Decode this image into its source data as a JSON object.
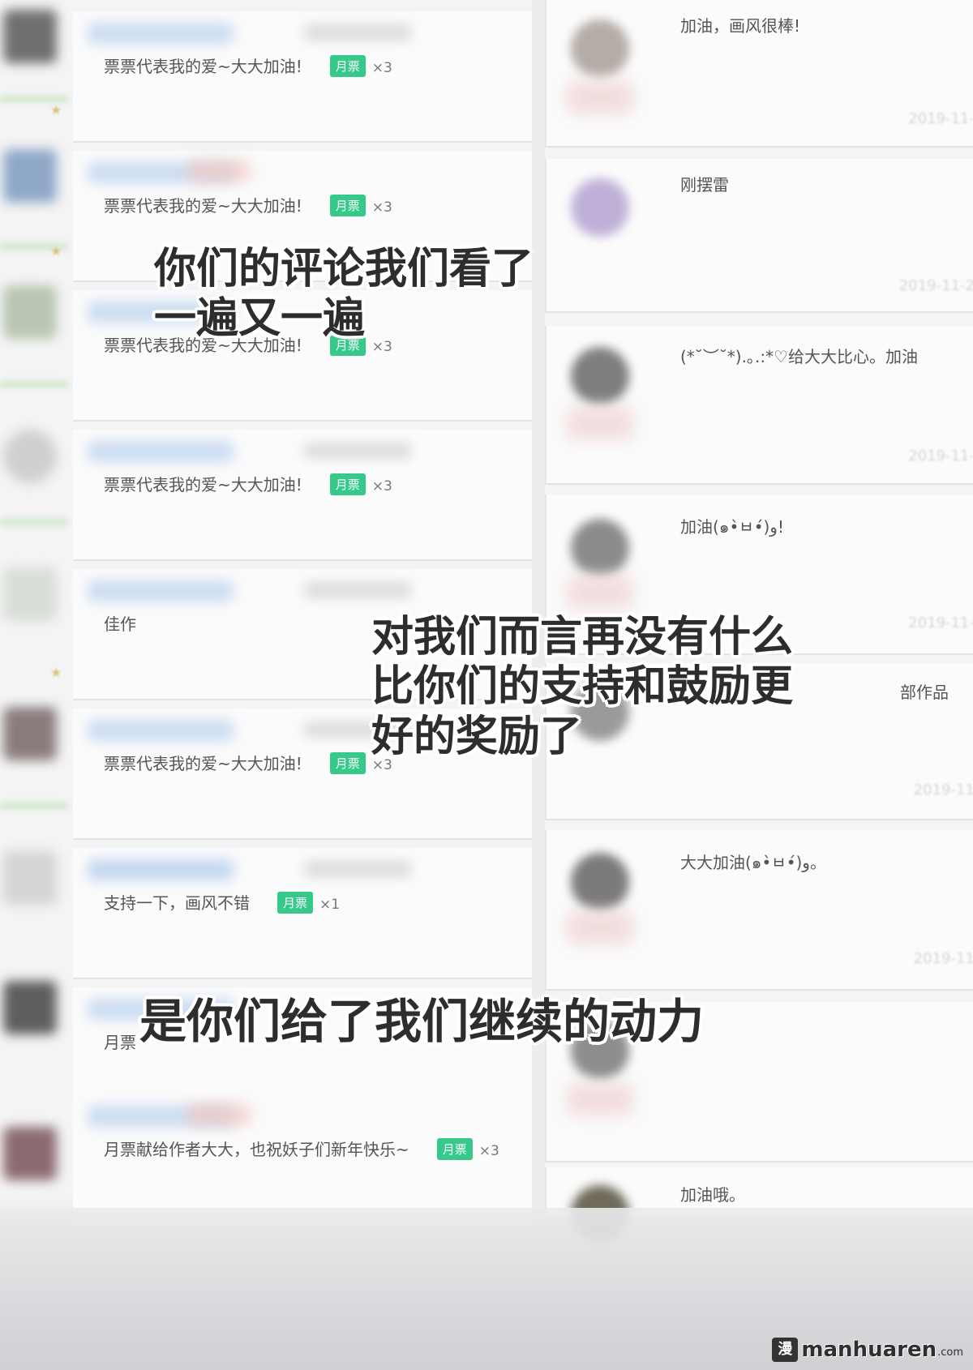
{
  "left_comments": [
    {
      "text": "票票代表我的爱~大大加油!",
      "badge": "月票",
      "count": "×3"
    },
    {
      "text": "票票代表我的爱~大大加油!",
      "badge": "月票",
      "count": "×3"
    },
    {
      "text": "票票代表我的爱~大大加油!",
      "badge": "月票",
      "count": "×3"
    },
    {
      "text": "票票代表我的爱~大大加油!",
      "badge": "月票",
      "count": "×3"
    },
    {
      "text": "佳作",
      "badge": "",
      "count": ""
    },
    {
      "text": "票票代表我的爱~大大加油!",
      "badge": "月票",
      "count": "×3"
    },
    {
      "text": "支持一下，画风不错",
      "badge": "月票",
      "count": "×1"
    },
    {
      "text": "月票",
      "badge": "",
      "count": ""
    },
    {
      "text": "月票献给作者大大，也祝妖子们新年快乐~",
      "badge": "月票",
      "count": "×3"
    }
  ],
  "right_comments": [
    {
      "text": "加油，画风很棒!",
      "date": "2019-11-"
    },
    {
      "text": "刚摆雷",
      "date": "2019-11-2"
    },
    {
      "text": "(*˘︶˘*).｡.:*♡给大大比心。加油",
      "date": "2019-11-"
    },
    {
      "text": "加油(๑•̀ㅂ•́)و!",
      "date": "2019-11-"
    },
    {
      "text": "部作品",
      "date": "2019-11"
    },
    {
      "text": "大大加油(๑•̀ㅂ•́)و。",
      "date": "2019-11"
    },
    {
      "text": "",
      "date": ""
    },
    {
      "text": "加油哦。",
      "date": ""
    }
  ],
  "captions": {
    "caption_1": "你们的评论我们看了\n一遍又一遍",
    "caption_2": "对我们而言再没有什么\n比你们的支持和鼓励更\n好的奖励了",
    "caption_3": "是你们给了我们继续的动力"
  },
  "watermark": {
    "text": "manhuaren",
    "tld": ".com",
    "icon": "manhuaren-logo-icon"
  },
  "colors": {
    "badge_green": "#35c98a",
    "caption_text": "#2d2d2d"
  }
}
